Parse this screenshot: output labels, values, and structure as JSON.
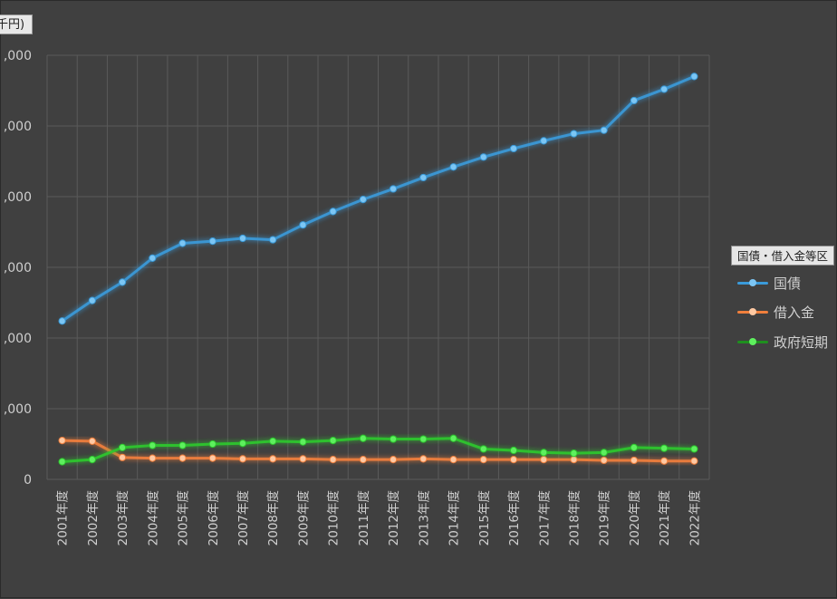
{
  "unit_label": "千円)",
  "legend_title": "国債・借入金等区",
  "colors": {
    "background": "#404040",
    "grid": "#5a5a5a",
    "text": "#cfcfcf"
  },
  "chart_data": {
    "type": "line",
    "title": "",
    "xlabel": "",
    "ylabel": "",
    "ylim": [
      0,
      60000
    ],
    "y_tick_labels": [
      {
        "value": 0,
        "label": "0"
      },
      {
        "value": 10000,
        "label": ",000"
      },
      {
        "value": 20000,
        "label": ",000"
      },
      {
        "value": 30000,
        "label": ",000"
      },
      {
        "value": 40000,
        "label": ",000"
      },
      {
        "value": 50000,
        "label": ",000"
      },
      {
        "value": 60000,
        "label": ",000"
      }
    ],
    "grid": true,
    "legend_position": "right",
    "categories": [
      "2001年度",
      "2002年度",
      "2003年度",
      "2004年度",
      "2005年度",
      "2006年度",
      "2007年度",
      "2008年度",
      "2009年度",
      "2010年度",
      "2011年度",
      "2012年度",
      "2013年度",
      "2014年度",
      "2015年度",
      "2016年度",
      "2017年度",
      "2018年度",
      "2019年度",
      "2020年度",
      "2021年度",
      "2022年度"
    ],
    "series": [
      {
        "name": "国債",
        "color": "#3a9ad9",
        "values": [
          22400,
          25300,
          27900,
          31300,
          33400,
          33700,
          34100,
          33900,
          36000,
          37900,
          39600,
          41100,
          42700,
          44200,
          45600,
          46800,
          47900,
          48900,
          49400,
          53600,
          55200,
          57000
        ]
      },
      {
        "name": "借入金",
        "color": "#f07f3c",
        "values": [
          5500,
          5400,
          3100,
          3000,
          3000,
          3000,
          2900,
          2900,
          2900,
          2800,
          2800,
          2800,
          2900,
          2800,
          2800,
          2800,
          2800,
          2800,
          2700,
          2700,
          2600,
          2600
        ]
      },
      {
        "name": "政府短期",
        "color": "#2ec72e",
        "values": [
          2500,
          2800,
          4500,
          4800,
          4800,
          5000,
          5100,
          5400,
          5300,
          5500,
          5800,
          5700,
          5700,
          5800,
          4300,
          4100,
          3800,
          3700,
          3800,
          4500,
          4400,
          4300
        ]
      }
    ]
  }
}
